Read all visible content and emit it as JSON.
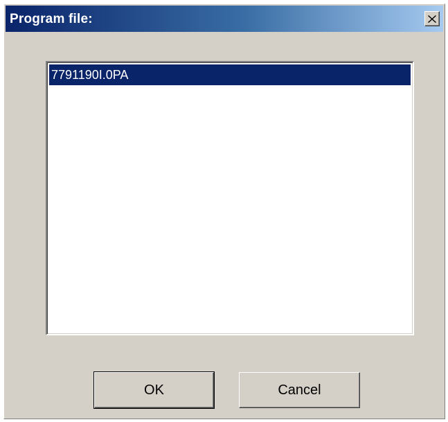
{
  "dialog": {
    "title": "Program file:",
    "close_icon": "close-icon"
  },
  "file_list": {
    "items": [
      {
        "label": "7791190I.0PA",
        "selected": true
      }
    ]
  },
  "buttons": {
    "ok_label": "OK",
    "cancel_label": "Cancel"
  },
  "colors": {
    "titlebar_start": "#0a246a",
    "titlebar_end": "#a6caf0",
    "selection": "#0a246a",
    "face": "#d4d0c8"
  }
}
